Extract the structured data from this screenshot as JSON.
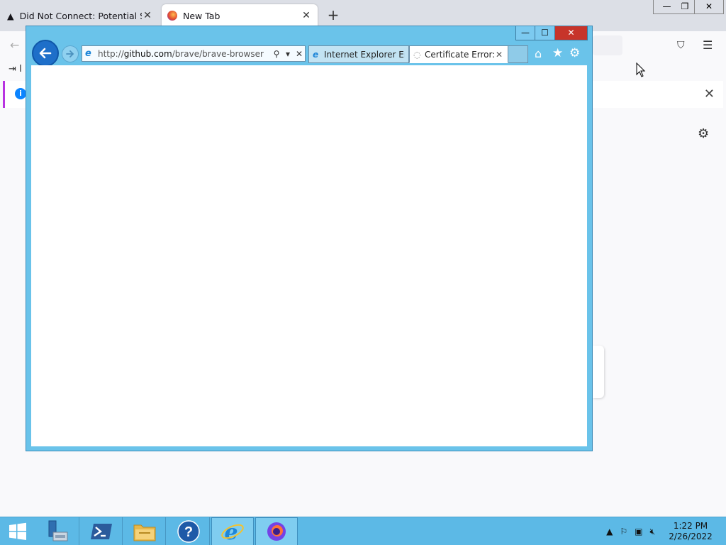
{
  "firefox": {
    "tabs": [
      {
        "title": "Did Not Connect: Potential Secu",
        "icon": "warning-icon"
      },
      {
        "title": "New Tab",
        "icon": "firefox-icon"
      }
    ],
    "window_controls": {
      "minimize": "—",
      "restore": "❐",
      "close": "✕"
    },
    "bookmark_stub": "I"
  },
  "ie": {
    "address": {
      "prefix": "http://",
      "host": "github.com",
      "path": "/brave/brave-browser"
    },
    "tabs": [
      {
        "title": "Internet Explorer En...",
        "icon": "ie-icon",
        "close": ""
      },
      {
        "title": "Certificate Error: ...",
        "icon": "loading-icon",
        "close": "✕"
      }
    ],
    "window_controls": {
      "minimize": "—",
      "maximize": "☐",
      "close": "✕"
    }
  },
  "taskbar": {
    "clock": {
      "time": "1:22 PM",
      "date": "2/26/2022"
    },
    "pinned": [
      "server-manager-icon",
      "powershell-icon",
      "file-explorer-icon",
      "help-icon",
      "ie-icon",
      "firefox-icon"
    ]
  },
  "colors": {
    "ie_frame": "#6ac3ea",
    "taskbar": "#5cb9e6",
    "ie_close": "#c7342a",
    "firefox_tabstrip": "#dcdfe6"
  }
}
